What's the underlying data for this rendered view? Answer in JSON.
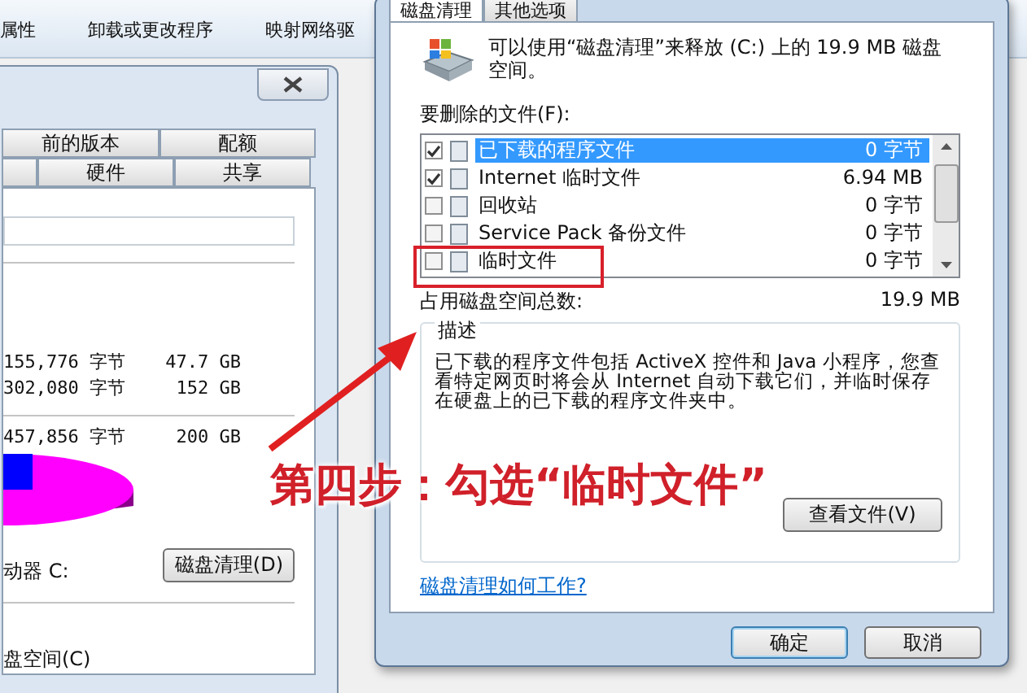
{
  "explorer_toolbar": {
    "items": [
      "属性",
      "卸载或更改程序",
      "映射网络驱"
    ]
  },
  "properties_dialog": {
    "tab_rows": [
      [
        {
          "label": "前的版本",
          "selected": false
        },
        {
          "label": "配额",
          "selected": false
        }
      ],
      [
        {
          "label": "硬件",
          "selected": false
        },
        {
          "label": "共享",
          "selected": false
        }
      ]
    ],
    "space_rows": [
      {
        "bytes": "155,776 字节",
        "size": "47.7 GB"
      },
      {
        "bytes": "302,080 字节",
        "size": "152 GB"
      },
      {
        "bytes": "457,856 字节",
        "size": "200 GB"
      }
    ],
    "drive_label": "动器 C:",
    "cleanup_button": "磁盘清理(D)",
    "compress_label": "盘空间(C)"
  },
  "cleanup_dialog": {
    "tabs": [
      {
        "label": "磁盘清理",
        "selected": true
      },
      {
        "label": "其他选项",
        "selected": false
      }
    ],
    "intro": "可以使用“磁盘清理”来释放  (C:) 上的 19.9 MB 磁盘空间。",
    "files_label": "要删除的文件(F):",
    "files": [
      {
        "name": "已下载的程序文件",
        "size": "0 字节",
        "checked": true,
        "selected": true
      },
      {
        "name": "Internet 临时文件",
        "size": "6.94 MB",
        "checked": true,
        "selected": false
      },
      {
        "name": "回收站",
        "size": "0 字节",
        "checked": false,
        "selected": false
      },
      {
        "name": "Service Pack 备份文件",
        "size": "0 字节",
        "checked": false,
        "selected": false
      },
      {
        "name": "临时文件",
        "size": "0 字节",
        "checked": false,
        "selected": false
      }
    ],
    "total_label": "占用磁盘空间总数:",
    "total": "19.9 MB",
    "description_title": "描述",
    "description": "已下载的程序文件包括 ActiveX 控件和 Java 小程序，您查看特定网页时将会从 Internet 自动下载它们，并临时保存在硬盘上的已下载的程序文件夹中。",
    "view_button": "查看文件(V)",
    "help_link": "磁盘清理如何工作?",
    "buttons": [
      "确定",
      "取消"
    ]
  },
  "annotation": {
    "text": "第四步：勾选“临时文件”"
  }
}
